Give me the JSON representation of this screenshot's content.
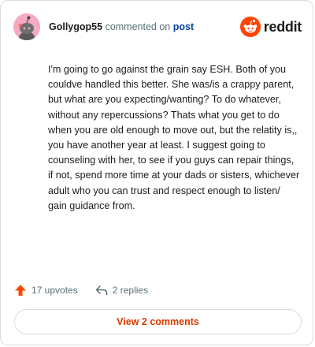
{
  "comment": {
    "author": "Gollygop55",
    "action_text": "commented on",
    "target_text": "post",
    "body": "I'm going to go against the grain say ESH. Both of you couldve handled this better. She was/is a crappy parent, but what are you expecting/wanting? To do whatever, without any repercussions? Thats what you get to do when you are old enough to move out, but the relatity is,, you have another year at least. I suggest going to counseling with her, to see if you guys can repair things, if not, spend more time at your dads or sisters, whichever adult who you can trust and respect enough to listen/ gain guidance from.",
    "upvotes_label": "17 upvotes",
    "replies_label": "2 replies"
  },
  "brand": {
    "wordmark": "reddit",
    "color": "#ff4500"
  },
  "footer": {
    "view_comments_label": "View 2 comments"
  },
  "colors": {
    "avatar_bg": "#f5a9c5",
    "accent": "#d93a00",
    "upvote": "#ff4500"
  },
  "icons": {
    "avatar": "snoo-avatar-icon",
    "logo": "reddit-logo-icon",
    "upvote": "upvote-arrow-icon",
    "reply": "reply-arrow-icon"
  }
}
